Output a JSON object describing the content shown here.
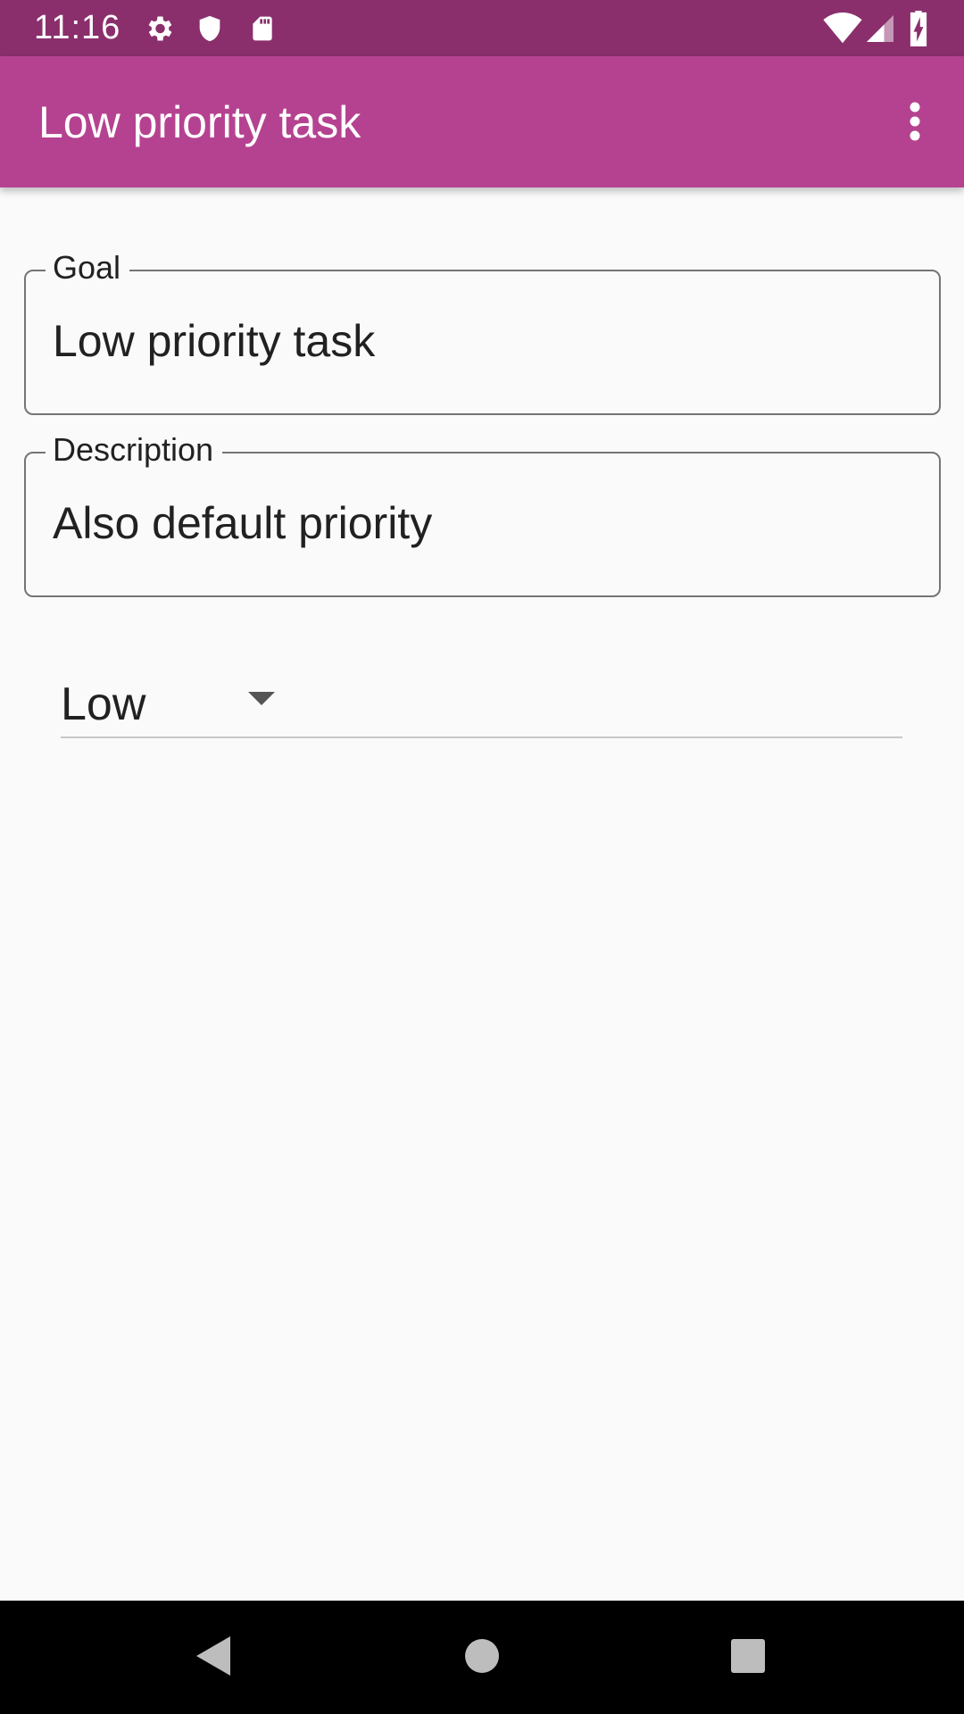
{
  "status_bar": {
    "time": "11:16",
    "icons": [
      "settings-icon",
      "shield-icon",
      "sd-card-icon",
      "wifi-icon",
      "signal-icon",
      "battery-charging-icon"
    ]
  },
  "app_bar": {
    "title": "Low priority task",
    "overflow_icon": "more-vert-icon",
    "background": "#b54290"
  },
  "form": {
    "goal": {
      "label": "Goal",
      "value": "Low priority task"
    },
    "description": {
      "label": "Description",
      "value": "Also default priority"
    },
    "priority": {
      "selected": "Low"
    }
  },
  "nav_bar": {
    "buttons": [
      "back-icon",
      "home-icon",
      "recents-icon"
    ]
  }
}
